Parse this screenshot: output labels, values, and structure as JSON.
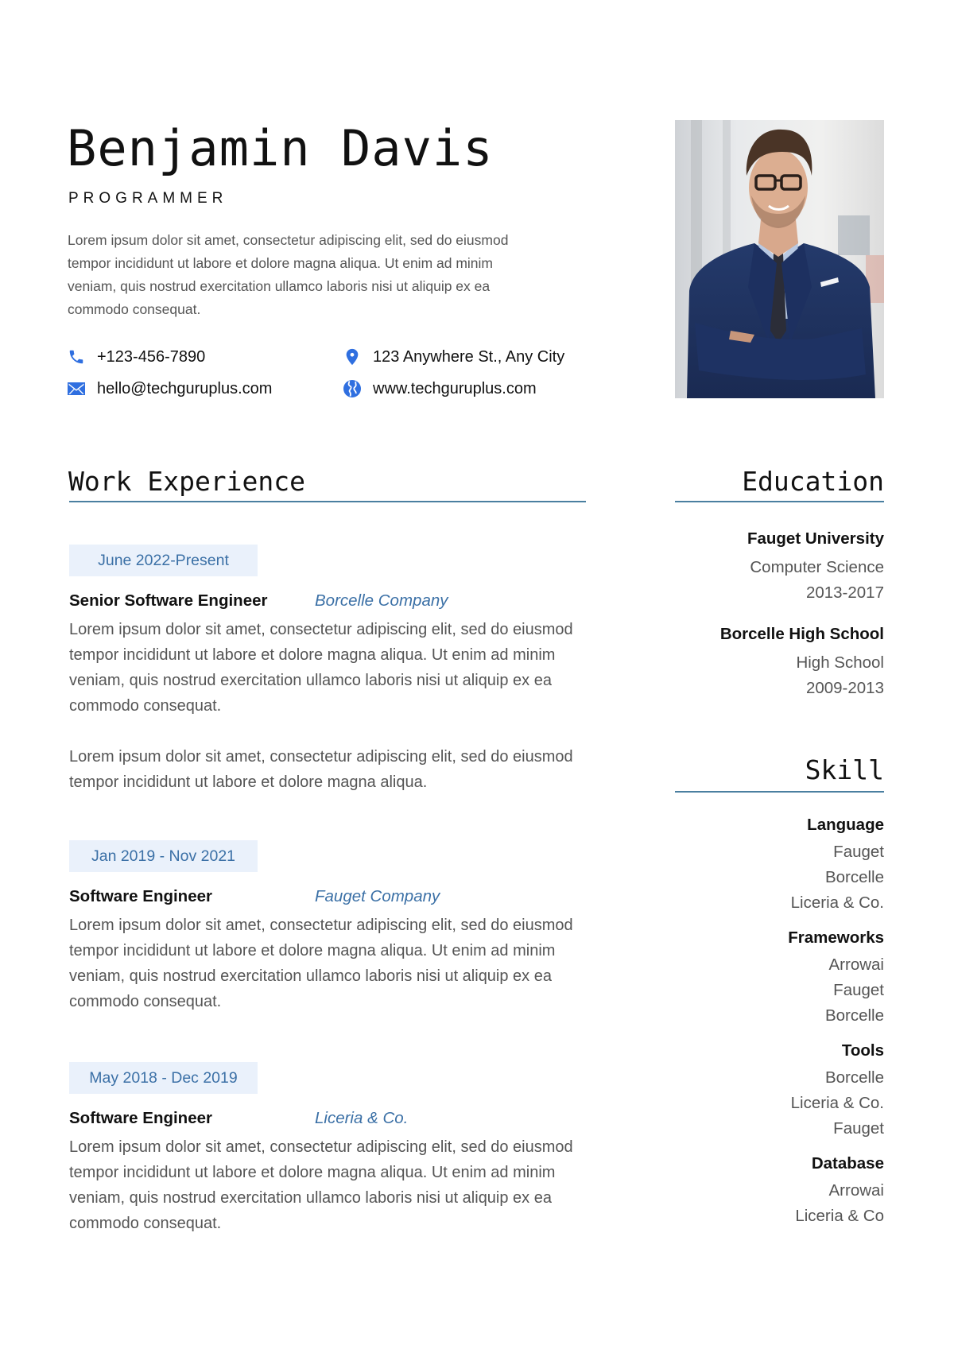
{
  "header": {
    "name": "Benjamin Davis",
    "role": "PROGRAMMER",
    "summary": "Lorem ipsum dolor sit amet, consectetur adipiscing elit, sed do eiusmod tempor incididunt ut labore et dolore magna aliqua. Ut enim ad minim veniam, quis nostrud exercitation ullamco laboris nisi ut aliquip ex ea commodo consequat.",
    "summary_lines": [
      "Lorem ipsum dolor sit amet, consectetur adipiscing elit, sed do eiusmod",
      "tempor incididunt ut labore et dolore magna aliqua. Ut enim ad minim",
      "veniam, quis nostrud exercitation ullamco laboris nisi ut aliquip ex ea",
      "commodo consequat."
    ],
    "contacts": {
      "phone": {
        "icon": "phone-icon",
        "value": "+123-456-7890"
      },
      "email": {
        "icon": "mail-icon",
        "value": "hello@techguruplus.com"
      },
      "address": {
        "icon": "location-pin-icon",
        "value": "123 Anywhere St., Any City"
      },
      "website": {
        "icon": "globe-icon",
        "value": "www.techguruplus.com"
      }
    },
    "photo_alt": "Portrait of man in navy suit with glasses, arms crossed"
  },
  "colors": {
    "accent": "#3b70a6",
    "icon_blue": "#2f6fe0",
    "chip_bg": "#eaf1fb",
    "rule": "#4a7fa0",
    "body_text": "#555555",
    "heading_text": "#111111"
  },
  "work": {
    "title": "Work Experience",
    "jobs": [
      {
        "dates": "June 2022-Present",
        "title": "Senior Software Engineer",
        "company": "Borcelle Company",
        "paragraphs": [
          "Lorem ipsum dolor sit amet, consectetur adipiscing elit, sed do eiusmod tempor incididunt ut labore et dolore magna aliqua. Ut enim ad minim veniam, quis nostrud exercitation ullamco laboris nisi ut aliquip ex ea commodo consequat.",
          "Lorem ipsum dolor sit amet, consectetur adipiscing elit, sed do eiusmod tempor incididunt ut labore et dolore magna aliqua."
        ]
      },
      {
        "dates": "Jan 2019 - Nov 2021",
        "title": "Software Engineer",
        "company": "Fauget Company",
        "paragraphs": [
          "Lorem ipsum dolor sit amet, consectetur adipiscing elit, sed do eiusmod tempor incididunt ut labore et dolore magna aliqua. Ut enim ad minim veniam, quis nostrud exercitation ullamco laboris nisi ut aliquip ex ea commodo consequat."
        ]
      },
      {
        "dates": "May 2018 - Dec 2019",
        "title": "Software Engineer",
        "company": "Liceria & Co.",
        "paragraphs": [
          "Lorem ipsum dolor sit amet, consectetur adipiscing elit, sed do eiusmod tempor incididunt ut labore et dolore magna aliqua. Ut enim ad minim veniam, quis nostrud exercitation ullamco laboris nisi ut aliquip ex ea commodo consequat."
        ]
      }
    ]
  },
  "education": {
    "title": "Education",
    "entries": [
      {
        "school": "Fauget University",
        "field": "Computer Science",
        "years": "2013-2017"
      },
      {
        "school": "Borcelle High School",
        "field": "High School",
        "years": "2009-2013"
      }
    ]
  },
  "skills": {
    "title": "Skill",
    "groups": [
      {
        "name": "Language",
        "items": [
          "Fauget",
          "Borcelle",
          "Liceria & Co."
        ]
      },
      {
        "name": "Frameworks",
        "items": [
          "Arrowai",
          "Fauget",
          "Borcelle"
        ]
      },
      {
        "name": "Tools",
        "items": [
          "Borcelle",
          "Liceria & Co.",
          "Fauget"
        ]
      },
      {
        "name": "Database",
        "items": [
          "Arrowai",
          "Liceria & Co"
        ]
      }
    ]
  }
}
